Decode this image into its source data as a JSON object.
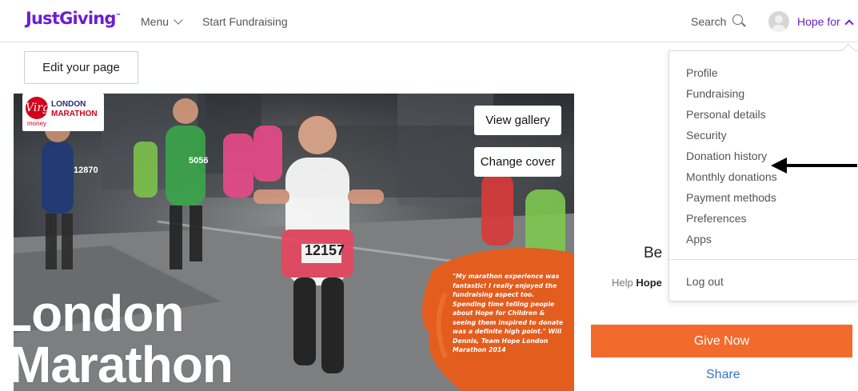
{
  "header": {
    "logo": "JustGiving",
    "logo_tm": "™",
    "menu_label": "Menu",
    "start_fundraising": "Start Fundraising",
    "search_label": "Search",
    "user_name": "Hope for"
  },
  "page": {
    "edit_button": "Edit your page",
    "view_gallery": "View gallery",
    "change_cover": "Change cover"
  },
  "cover": {
    "sponsor_line1": "LONDON",
    "sponsor_line2": "MARATHON",
    "sponsor_brand": "Virgin",
    "sponsor_money": "money",
    "title_line1": "London",
    "title_line2": "Marathon",
    "quote": "\"My marathon experience was fantastic! I really enjoyed the fundraising aspect too. Spending time telling people about Hope for Children & seeing them inspired to donate was a definite high point.\" Will Dennis, Team Hope London Marathon 2014",
    "bib_main": "12157",
    "bib_left": "12870",
    "bib_green": "5056"
  },
  "sidebar": {
    "be_text": "Be",
    "help_prefix": "Help",
    "help_name": "Hope",
    "give_now": "Give Now",
    "share": "Share"
  },
  "dropdown": {
    "items": [
      "Profile",
      "Fundraising",
      "Personal details",
      "Security",
      "Donation history",
      "Monthly donations",
      "Payment methods",
      "Preferences",
      "Apps"
    ],
    "logout": "Log out"
  },
  "colors": {
    "brand_purple": "#6b1dd2",
    "give_orange": "#f26a2c",
    "share_blue": "#3572c9"
  }
}
